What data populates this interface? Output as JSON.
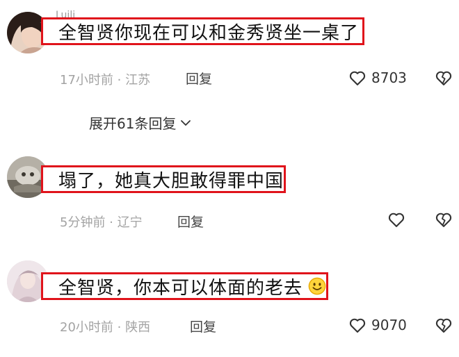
{
  "comments": [
    {
      "username": "Luili",
      "text": "全智贤你现在可以和金秀贤坐一桌了",
      "time": "17小时前",
      "location": "江苏",
      "reply_label": "回复",
      "likes": "8703",
      "emoji": "smile-emoji-icon"
    },
    {
      "username": "",
      "text": "塌了，她真大胆敢得罪中国",
      "time": "5分钟前",
      "location": "辽宁",
      "reply_label": "回复",
      "likes": ""
    },
    {
      "username": "",
      "text": "全智贤，你本可以体面的老去",
      "time": "20小时前",
      "location": "陕西",
      "reply_label": "回复",
      "likes": "9070",
      "emoji": "smile-emoji-icon"
    }
  ],
  "expand_replies": {
    "label": "展开61条回复"
  },
  "colors": {
    "highlight_border": "#e0131b",
    "meta_text": "#a3a3a3"
  },
  "meta_separator": " · "
}
